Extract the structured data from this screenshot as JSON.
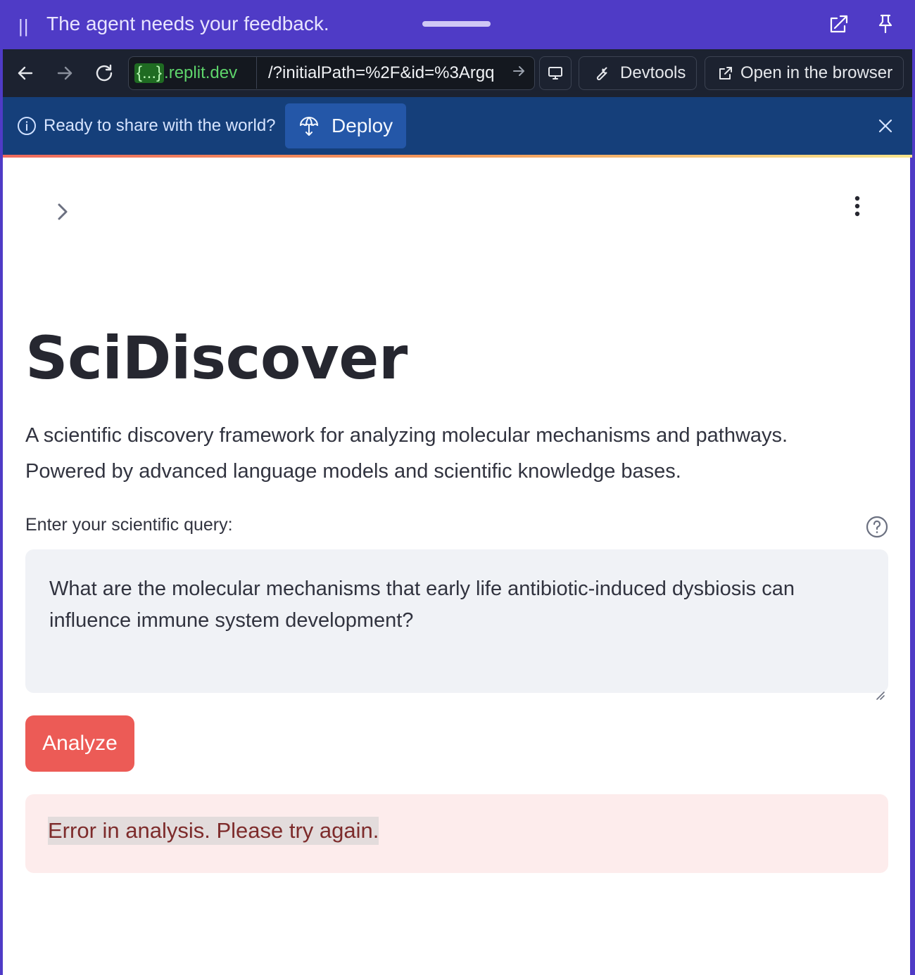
{
  "feedback_bar": {
    "grip": "||",
    "message": "The agent needs your feedback."
  },
  "browser": {
    "url_host_braces": "{...}",
    "url_host_domain": ".replit.dev",
    "url_path": "/?initialPath=%2F&id=%3Argq",
    "devtools_label": "Devtools",
    "open_browser_label": "Open in the browser"
  },
  "banner": {
    "text": "Ready to share with the world?",
    "deploy_label": "Deploy"
  },
  "app": {
    "title": "SciDiscover",
    "description_line1": "A scientific discovery framework for analyzing molecular mechanisms and pathways.",
    "description_line2": "Powered by advanced language models and scientific knowledge bases.",
    "query_label": "Enter your scientific query:",
    "query_value": "What are the molecular mechanisms that early life antibiotic-induced dysbiosis can influence immune system development?",
    "analyze_label": "Analyze",
    "error_message": "Error in analysis. Please try again."
  },
  "colors": {
    "top_bar": "#4f3bc6",
    "browser_bar": "#1c2230",
    "banner": "#153f7a",
    "deploy_button": "#2457a8",
    "primary_button": "#ec5b56",
    "error_bg": "#fdecec",
    "error_text": "#7d2b2b"
  },
  "icons": [
    "drag-grip-icon",
    "popout-icon",
    "pin-icon",
    "back-icon",
    "forward-icon",
    "reload-icon",
    "arrow-right-icon",
    "monitor-icon",
    "wrench-icon",
    "external-link-icon",
    "info-icon",
    "deploy-icon",
    "close-icon",
    "chevron-right-icon",
    "kebab-menu-icon",
    "help-icon",
    "resize-grip-icon"
  ]
}
